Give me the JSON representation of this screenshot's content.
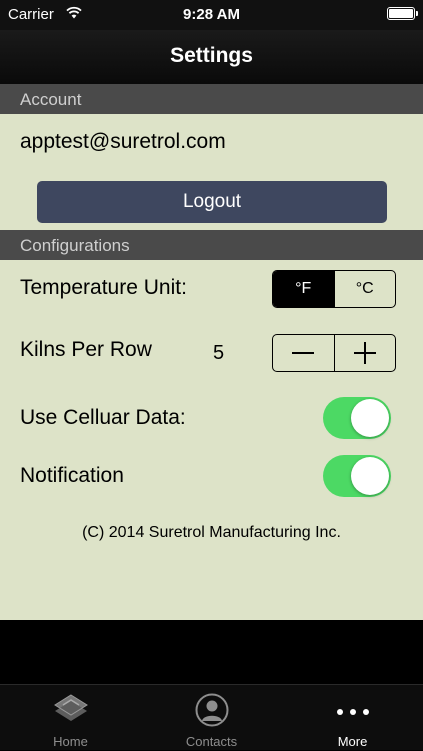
{
  "status_bar": {
    "carrier": "Carrier",
    "time": "9:28 AM"
  },
  "nav": {
    "title": "Settings"
  },
  "account": {
    "header": "Account",
    "email": "apptest@suretrol.com",
    "logout_label": "Logout"
  },
  "configurations": {
    "header": "Configurations",
    "temperature_label": "Temperature Unit:",
    "temperature_options": [
      "°F",
      "°C"
    ],
    "temperature_selected": "°F",
    "kilns_label": "Kilns Per Row",
    "kilns_value": "5",
    "cellular_label": "Use Celluar Data:",
    "cellular_on": true,
    "notification_label": "Notification",
    "notification_on": true
  },
  "copyright": "(C) 2014 Suretrol Manufacturing Inc.",
  "tabs": [
    {
      "label": "Home",
      "icon": "home-logo-icon"
    },
    {
      "label": "Contacts",
      "icon": "contacts-icon"
    },
    {
      "label": "More",
      "icon": "more-dots-icon",
      "selected": true
    }
  ],
  "colors": {
    "content_bg": "#dde3c8",
    "section_header_bg": "#4a4a4a",
    "logout_bg": "#3e475f",
    "toggle_on": "#4cd964",
    "tab_inactive": "#8e8e8e",
    "tab_active": "#ffffff"
  }
}
